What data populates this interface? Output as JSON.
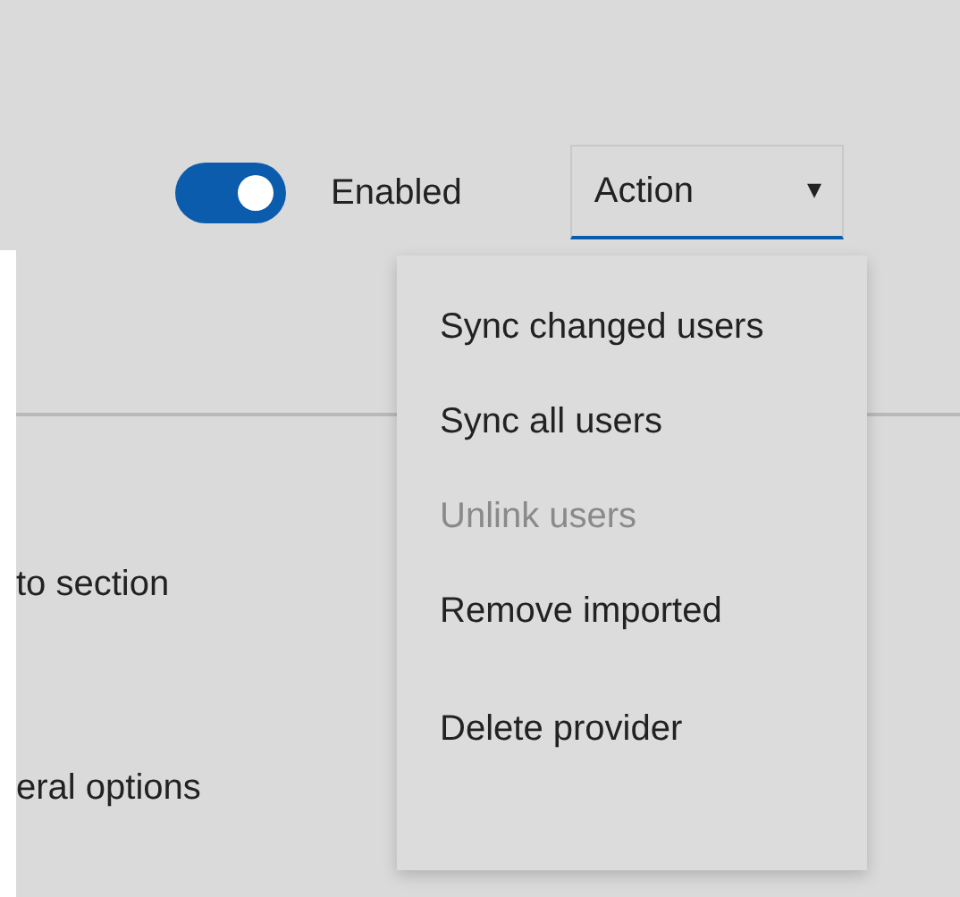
{
  "toggle": {
    "label": "Enabled",
    "on": true
  },
  "action_dropdown": {
    "label": "Action",
    "caret": "▾"
  },
  "section_labels": [
    "to section",
    "eral options"
  ],
  "menu": [
    {
      "label": "Sync changed users",
      "disabled": false
    },
    {
      "label": "Sync all users",
      "disabled": false
    },
    {
      "label": "Unlink users",
      "disabled": true
    },
    {
      "label": "Remove imported",
      "disabled": false
    },
    {
      "label": "Delete provider",
      "disabled": false,
      "separated": true
    }
  ]
}
